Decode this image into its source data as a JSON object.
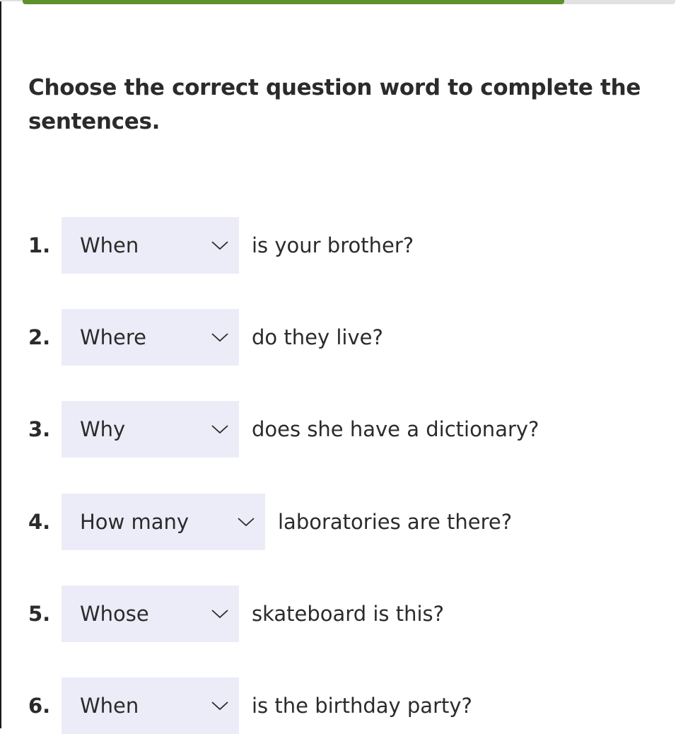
{
  "progress": {
    "percent": 83,
    "fill_color": "#5e9129",
    "track_color": "#e2e1e2"
  },
  "instructions": "Choose the correct question word to complete the sentences.",
  "dropdown_background": "#ececf8",
  "questions": [
    {
      "number": "1.",
      "selected": "When",
      "rest": "is your brother?"
    },
    {
      "number": "2.",
      "selected": "Where",
      "rest": "do they live?"
    },
    {
      "number": "3.",
      "selected": "Why",
      "rest": "does she have a dictionary?"
    },
    {
      "number": "4.",
      "selected": "How many",
      "rest": "laboratories are there?"
    },
    {
      "number": "5.",
      "selected": "Whose",
      "rest": "skateboard is this?"
    },
    {
      "number": "6.",
      "selected": "When",
      "rest": "is the birthday party?"
    }
  ]
}
